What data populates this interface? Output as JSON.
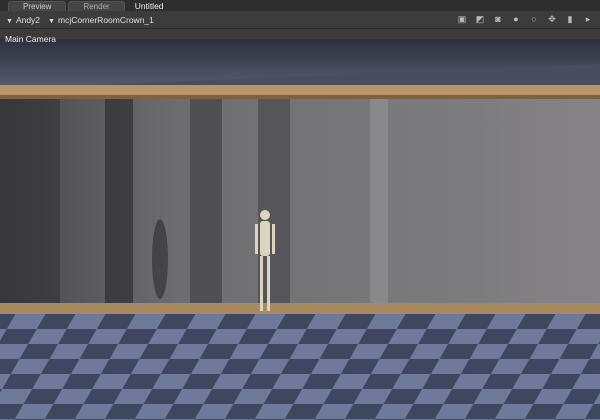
{
  "tabs": [
    {
      "label": "Preview",
      "active": true
    },
    {
      "label": "Render",
      "active": false
    }
  ],
  "document_title": "Untitled",
  "toolbar": {
    "figure": "Andy2",
    "prop": "mcjCornerRoomCrown_1",
    "icons": [
      "camera-icon",
      "display-icon",
      "shaded-style-icon",
      "sphere-style-icon",
      "outline-style-icon",
      "move-icon",
      "zoom-icon",
      "expand-arrow-icon"
    ]
  },
  "viewport": {
    "camera_label": "Main Camera"
  }
}
